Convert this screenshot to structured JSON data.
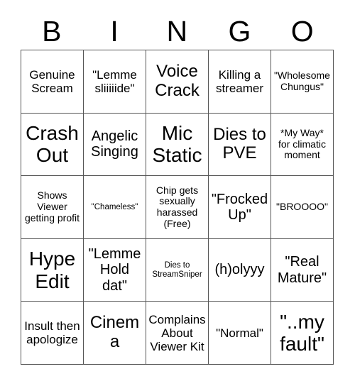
{
  "header": {
    "letters": [
      "B",
      "I",
      "N",
      "G",
      "O"
    ]
  },
  "colors": {
    "background": "#ffffff",
    "border": "#555555",
    "text": "#000000"
  },
  "grid": {
    "rows": 5,
    "columns": 5,
    "cells": [
      [
        {
          "text": "Genuine Scream",
          "size": "fs-md"
        },
        {
          "text": "\"Lemme sliiiiide\"",
          "size": "fs-md"
        },
        {
          "text": "Voice Crack",
          "size": "fs-xl"
        },
        {
          "text": "Killing a streamer",
          "size": "fs-md"
        },
        {
          "text": "\"Wholesome Chungus\"",
          "size": "fs-sm"
        }
      ],
      [
        {
          "text": "Crash Out",
          "size": "fs-xxl"
        },
        {
          "text": "Angelic Singing",
          "size": "fs-lg"
        },
        {
          "text": "Mic Static",
          "size": "fs-xxl"
        },
        {
          "text": "Dies to PVE",
          "size": "fs-xl"
        },
        {
          "text": "*My Way* for climatic moment",
          "size": "fs-sm"
        }
      ],
      [
        {
          "text": "Shows Viewer getting profit",
          "size": "fs-sm"
        },
        {
          "text": "\"Chameless\"",
          "size": "fs-xs"
        },
        {
          "text": "Chip gets sexually harassed (Free)",
          "size": "fs-sm"
        },
        {
          "text": "\"Frocked Up\"",
          "size": "fs-lg"
        },
        {
          "text": "\"BROOOO\"",
          "size": "fs-sm"
        }
      ],
      [
        {
          "text": "Hype Edit",
          "size": "fs-xxl"
        },
        {
          "text": "\"Lemme Hold dat\"",
          "size": "fs-lg"
        },
        {
          "text": "Dies to StreamSniper",
          "size": "fs-xs"
        },
        {
          "text": "(h)olyyy",
          "size": "fs-lg"
        },
        {
          "text": "\"Real Mature\"",
          "size": "fs-lg"
        }
      ],
      [
        {
          "text": "Insult then apologize",
          "size": "fs-md"
        },
        {
          "text": "Cinema",
          "size": "fs-xl"
        },
        {
          "text": "Complains About Viewer Kit",
          "size": "fs-md"
        },
        {
          "text": "\"Normal\"",
          "size": "fs-md"
        },
        {
          "text": "\"..my fault\"",
          "size": "fs-xxl"
        }
      ]
    ]
  }
}
